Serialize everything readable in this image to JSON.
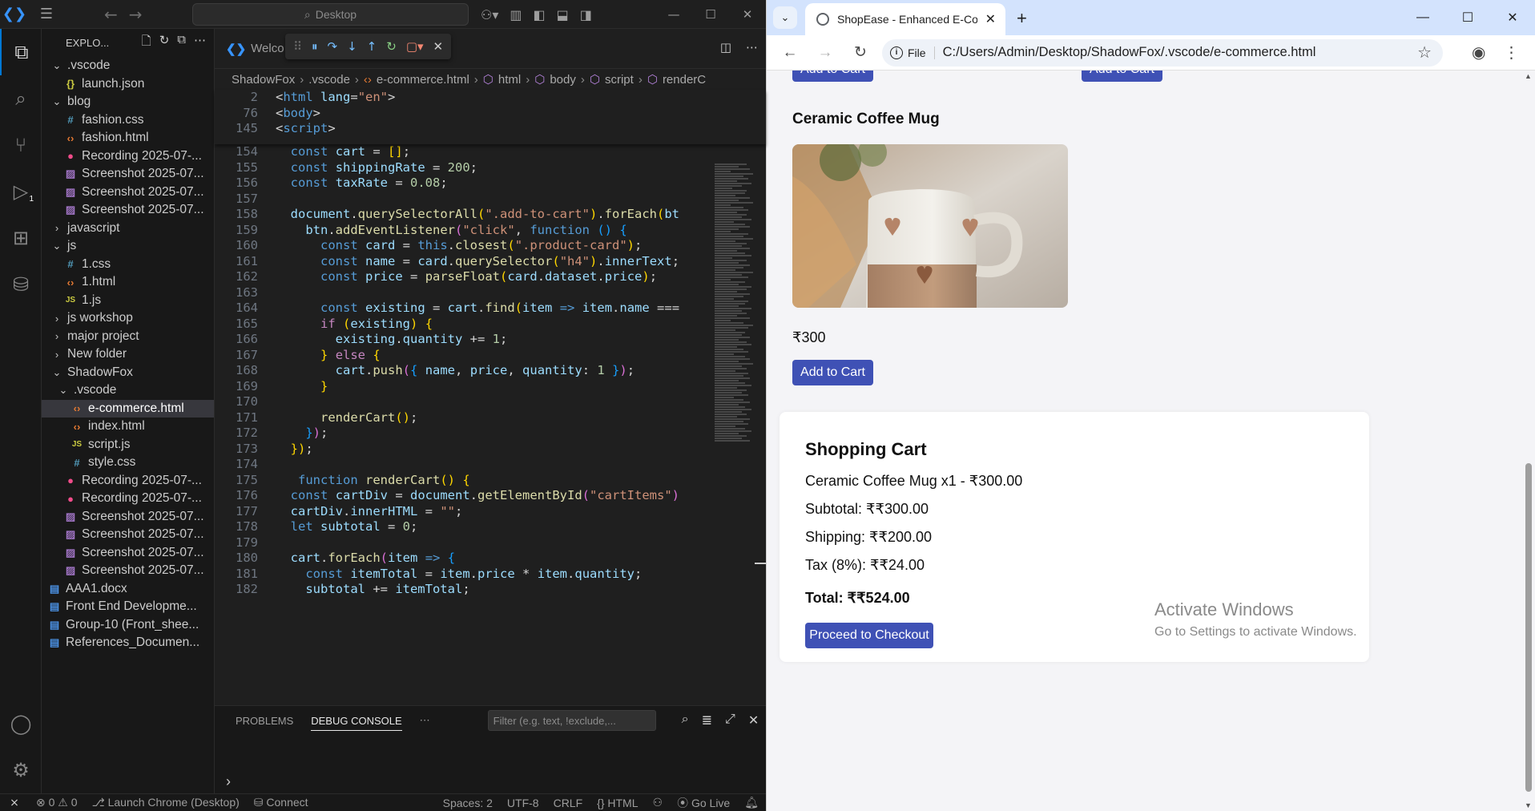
{
  "vscode": {
    "search_text": "Desktop",
    "explorer_title": "EXPLO...",
    "welcome_tab": "Welco",
    "tree": [
      {
        "label": ".vscode",
        "type": "folder-open",
        "indent": 1
      },
      {
        "label": "launch.json",
        "type": "json",
        "indent": 2
      },
      {
        "label": "blog",
        "type": "folder-open",
        "indent": 1
      },
      {
        "label": "fashion.css",
        "type": "css",
        "indent": 2
      },
      {
        "label": "fashion.html",
        "type": "html",
        "indent": 2
      },
      {
        "label": "Recording 2025-07-...",
        "type": "rec",
        "indent": 2
      },
      {
        "label": "Screenshot 2025-07...",
        "type": "img",
        "indent": 2
      },
      {
        "label": "Screenshot 2025-07...",
        "type": "img",
        "indent": 2
      },
      {
        "label": "Screenshot 2025-07...",
        "type": "img",
        "indent": 2
      },
      {
        "label": "javascript",
        "type": "folder-closed",
        "indent": 1
      },
      {
        "label": "js",
        "type": "folder-open",
        "indent": 1
      },
      {
        "label": "1.css",
        "type": "css",
        "indent": 2
      },
      {
        "label": "1.html",
        "type": "html",
        "indent": 2
      },
      {
        "label": "1.js",
        "type": "js",
        "indent": 2
      },
      {
        "label": "js workshop",
        "type": "folder-closed",
        "indent": 1
      },
      {
        "label": "major project",
        "type": "folder-closed",
        "indent": 1
      },
      {
        "label": "New folder",
        "type": "folder-closed",
        "indent": 1
      },
      {
        "label": "ShadowFox",
        "type": "folder-open",
        "indent": 1
      },
      {
        "label": ".vscode",
        "type": "folder-open",
        "indent": 2
      },
      {
        "label": "e-commerce.html",
        "type": "html",
        "indent": 3,
        "selected": true
      },
      {
        "label": "index.html",
        "type": "html",
        "indent": 3
      },
      {
        "label": "script.js",
        "type": "js",
        "indent": 3
      },
      {
        "label": "style.css",
        "type": "css",
        "indent": 3
      },
      {
        "label": "Recording 2025-07-...",
        "type": "rec",
        "indent": 2
      },
      {
        "label": "Recording 2025-07-...",
        "type": "rec",
        "indent": 2
      },
      {
        "label": "Screenshot 2025-07...",
        "type": "img",
        "indent": 2
      },
      {
        "label": "Screenshot 2025-07...",
        "type": "img",
        "indent": 2
      },
      {
        "label": "Screenshot 2025-07...",
        "type": "img",
        "indent": 2
      },
      {
        "label": "Screenshot 2025-07...",
        "type": "img",
        "indent": 2
      },
      {
        "label": "AAA1.docx",
        "type": "doc",
        "indent": 0
      },
      {
        "label": "Front End Developme...",
        "type": "doc",
        "indent": 0
      },
      {
        "label": "Group-10 (Front_shee...",
        "type": "doc",
        "indent": 0
      },
      {
        "label": "References_Documen...",
        "type": "doc",
        "indent": 0
      }
    ],
    "breadcrumb": [
      "ShadowFox",
      ".vscode",
      "e-commerce.html",
      "html",
      "body",
      "script",
      "renderC"
    ],
    "sticky_lines": [
      "2",
      "76",
      "145"
    ],
    "code_start_line": 154,
    "debug_badge": "1",
    "panel": {
      "tabs": [
        "PROBLEMS",
        "DEBUG CONSOLE"
      ],
      "active_tab": "DEBUG CONSOLE",
      "filter_placeholder": "Filter (e.g. text, !exclude,..."
    },
    "status": {
      "errors": "0",
      "warnings": "0",
      "launch": "Launch Chrome (Desktop)",
      "connect": "Connect",
      "spaces": "Spaces: 2",
      "encoding": "UTF-8",
      "eol": "CRLF",
      "language": "HTML",
      "golive": "Go Live"
    }
  },
  "chrome": {
    "tab_title": "ShopEase - Enhanced E-Comme",
    "url_chip": "File",
    "url": "C:/Users/Admin/Desktop/ShadowFox/.vscode/e-commerce.html",
    "page": {
      "top_button_label": "Add to Cart",
      "product_title": "Ceramic Coffee Mug",
      "product_price": "₹300",
      "add_to_cart": "Add to Cart",
      "cart_title": "Shopping Cart",
      "cart_item": "Ceramic Coffee Mug x1 - ₹300.00",
      "subtotal": "Subtotal: ₹₹300.00",
      "shipping": "Shipping: ₹₹200.00",
      "tax": "Tax (8%): ₹₹24.00",
      "total": "Total: ₹₹524.00",
      "checkout": "Proceed to Checkout"
    },
    "watermark": {
      "line1": "Activate Windows",
      "line2": "Go to Settings to activate Windows."
    }
  },
  "colors": {
    "accent_button": "#3f51b5",
    "vscode_bg": "#1f1f1f",
    "chrome_tabbar": "#d3e3fd"
  }
}
